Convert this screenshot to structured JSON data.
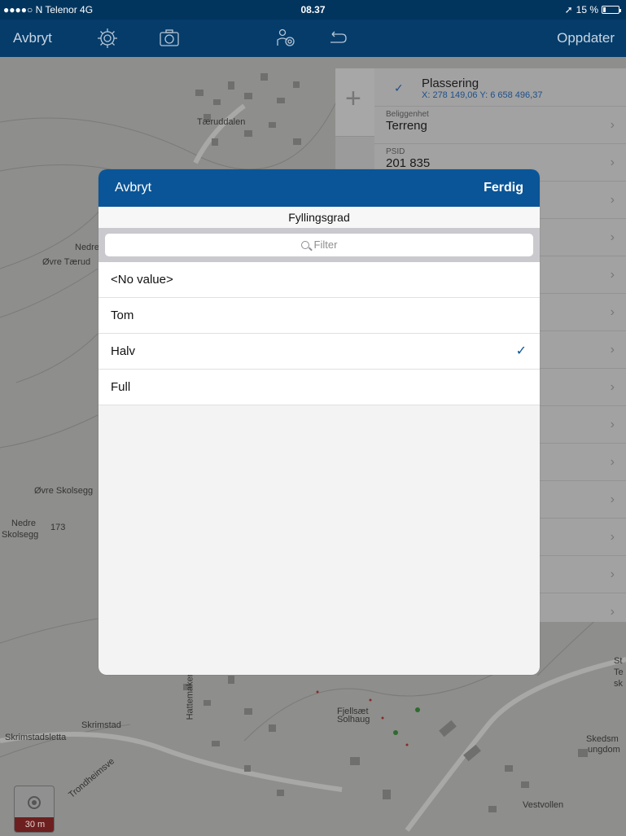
{
  "status": {
    "carrier": "●●●●○ N Telenor  4G",
    "time": "08.37",
    "battery": "15 %",
    "arrow": "➚"
  },
  "nav": {
    "cancel": "Avbryt",
    "update": "Oppdater"
  },
  "map_labels": [
    "Tæruddalen",
    "Nedre",
    "Øvre Tærud",
    "Øvre Skolsegg",
    "Nedre",
    "Skolsegg",
    "173",
    "Skrimstad",
    "Skrimstadsletta",
    "Fjellsæt",
    "Solhaug",
    "Vestvollen",
    "Skedsm",
    "ungdom",
    "Trondheimsve",
    "Hattemaker",
    "St",
    "Te",
    "sk"
  ],
  "side_panel": {
    "header_title": "Plassering",
    "header_coords": "X: 278 149,06 Y: 6 658 496,37",
    "rows": [
      {
        "label": "Beliggenhet",
        "value": "Terreng"
      },
      {
        "label": "PSID",
        "value": "201 835"
      }
    ]
  },
  "scale": {
    "label": "30 m"
  },
  "modal": {
    "cancel": "Avbryt",
    "done": "Ferdig",
    "title": "Fyllingsgrad",
    "filter_placeholder": "Filter",
    "options": [
      {
        "label": "<No value>",
        "selected": false
      },
      {
        "label": "Tom",
        "selected": false
      },
      {
        "label": "Halv",
        "selected": true
      },
      {
        "label": "Full",
        "selected": false
      }
    ]
  }
}
